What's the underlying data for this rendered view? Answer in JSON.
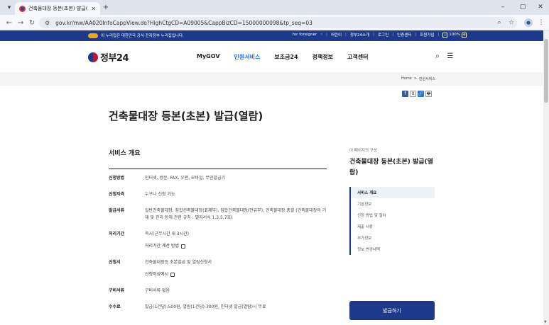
{
  "browser": {
    "tab_title": "건축물대장 등본(초본) 발급(열",
    "tab_close": "✕",
    "new_tab": "+",
    "url": "gov.kr/mw/AA020InfoCappView.do?HighCtgCD=A09005&CappBizCD=15000000098&tp_seq=03",
    "window_controls": [
      "–",
      "▢",
      "✕"
    ]
  },
  "gov_banner": {
    "notice": "이 누리집은 대한민국 공식 전자정부 누리집입니다.",
    "links": [
      "for foreigner",
      "어린이",
      "정부24소개",
      "로그인",
      "인증센터",
      "회원가입"
    ],
    "zoom_minus": "−",
    "zoom_level": "100%",
    "zoom_plus": "+"
  },
  "header": {
    "logo_text": "정부24",
    "nav": [
      "MyGOV",
      "민원서비스",
      "보조금24",
      "정책정보",
      "고객센터"
    ],
    "active_nav_index": 1,
    "accent_color": "#256ef4"
  },
  "breadcrumb": {
    "home": "Home",
    "separator": ">",
    "current": "민원서비스"
  },
  "share": {
    "facebook": "f",
    "x": "X",
    "link": "🔗",
    "print": "🖶"
  },
  "page_title": "건축물대장 등본(초본) 발급(열람)",
  "overview": {
    "section_title": "서비스 개요",
    "rows": [
      {
        "label": "신청방법",
        "value": "인터넷, 방문, FAX, 우편, 모바일, 무인발급기"
      },
      {
        "label": "신청자격",
        "value": "누구나 신청 가능"
      },
      {
        "label": "발급서류",
        "value": "일반건축물대장, 집합건축물대장(표제부), 집합건축물대장(전유부), 건축물대장 총괄 (건축물대장의 기재 및 관리 등에 관한 규칙 : 별지서식 1,3,5,7호)"
      },
      {
        "label": "처리기간",
        "value": "즉시(근무시간 내 3시간)",
        "link": "처리기간 계산 방법"
      },
      {
        "label": "신청서",
        "value": "건축물대장등.초본발급 및 열람신청서",
        "link": "신청작성예시"
      },
      {
        "label": "구비서류",
        "value": "구비서류 없음"
      },
      {
        "label": "수수료",
        "value": "발급(1건당):500원, 열람(1건당):300원, 인터넷 발급(열람)시 무료"
      }
    ]
  },
  "aside": {
    "caption": "이 페이지의 구성",
    "title": "건축물대장 등본(초본) 발급(열람)",
    "nav": [
      "서비스 개요",
      "기본정보",
      "신청 방법 및 절차",
      "제출 서류",
      "부가정보",
      "정보 변경내역"
    ],
    "active_index": 0,
    "issue_button": "발급하기"
  },
  "colors": {
    "brand_navy": "#1d3a8a",
    "link_blue": "#256ef4"
  }
}
